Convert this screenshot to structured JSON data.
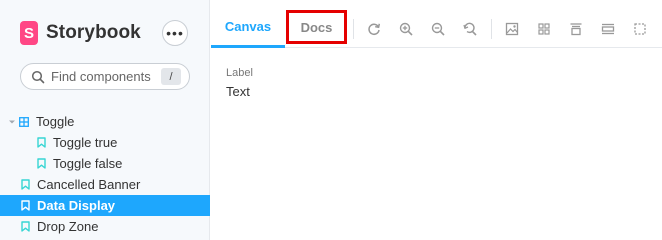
{
  "brand": {
    "name": "Storybook",
    "logo_letter": "S",
    "color": "#ff4785"
  },
  "sidebar": {
    "more_label": "•••",
    "search": {
      "placeholder": "Find components",
      "shortcut": "/"
    },
    "tree": [
      {
        "label": "Toggle",
        "type": "component",
        "expanded": true,
        "icon": "component-icon"
      },
      {
        "label": "Toggle true",
        "type": "story",
        "icon": "bookmark-icon"
      },
      {
        "label": "Toggle false",
        "type": "story",
        "icon": "bookmark-icon"
      },
      {
        "label": "Cancelled Banner",
        "type": "story",
        "icon": "bookmark-icon"
      },
      {
        "label": "Data Display",
        "type": "story",
        "icon": "bookmark-icon",
        "selected": true
      },
      {
        "label": "Drop Zone",
        "type": "story",
        "icon": "bookmark-icon"
      }
    ]
  },
  "toolbar": {
    "tabs": [
      {
        "label": "Canvas",
        "active": true
      },
      {
        "label": "Docs",
        "highlighted": true
      }
    ],
    "tools": [
      "reload-icon",
      "zoom-in-icon",
      "zoom-out-icon",
      "zoom-reset-icon",
      "background-icon",
      "grid-icon",
      "viewport-icon",
      "measure-icon",
      "outline-icon"
    ]
  },
  "preview": {
    "label": "Label",
    "value": "Text"
  },
  "colors": {
    "accent": "#1ea7fd",
    "highlight_border": "#e50000",
    "brand": "#ff4785"
  }
}
